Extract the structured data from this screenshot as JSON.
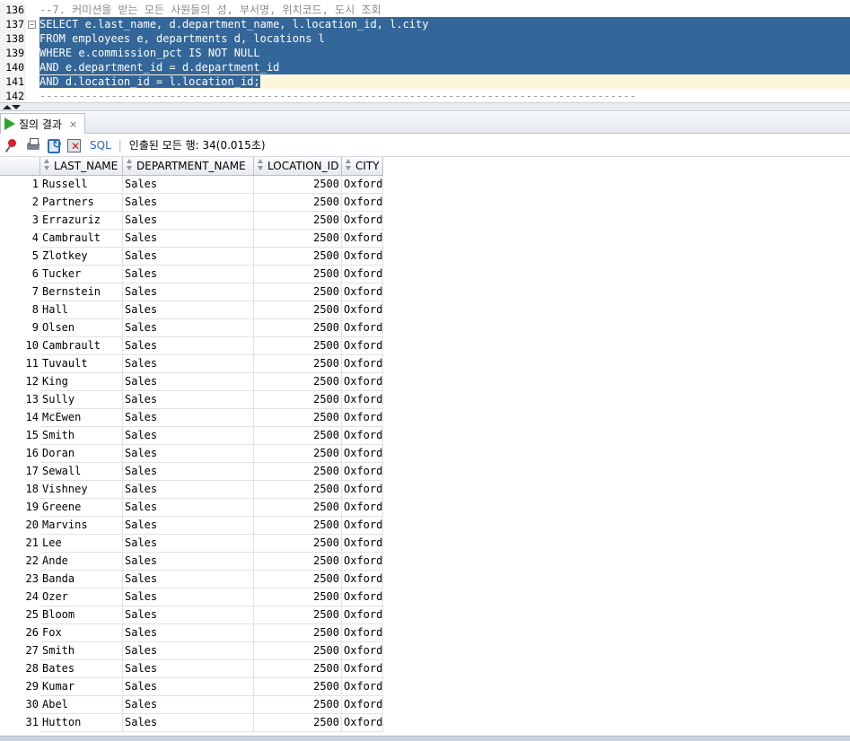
{
  "editor": {
    "lines": [
      {
        "num": "136",
        "text": "--7. 커미션을 받는 모든 사원들의 성, 부서명, 위치코드, 도시 조회",
        "kind": "cmt"
      },
      {
        "num": "137",
        "text": "SELECT e.last_name, d.department_name, l.location_id, l.city",
        "kind": "sel",
        "fold": true
      },
      {
        "num": "138",
        "text": "FROM employees e, departments d, locations l",
        "kind": "sel"
      },
      {
        "num": "139",
        "text": "WHERE e.commission_pct IS NOT NULL",
        "kind": "sel"
      },
      {
        "num": "140",
        "text": "AND e.department_id = d.department_id",
        "kind": "sel"
      },
      {
        "num": "141",
        "text": "AND d.location_id = l.location_id;",
        "kind": "cur"
      },
      {
        "num": "142",
        "text": "--------------------------------------------------------------------------------------------",
        "kind": "dash"
      }
    ],
    "fold_symbol": "⊟"
  },
  "results_tab": {
    "label": "질의 결과",
    "close": "×"
  },
  "toolbar": {
    "sql_label": "SQL",
    "separator": "|",
    "status": "인출된 모든 행: 34(0.015초)"
  },
  "grid": {
    "columns": [
      "LAST_NAME",
      "DEPARTMENT_NAME",
      "LOCATION_ID",
      "CITY"
    ],
    "rows": [
      [
        "1",
        "Russell",
        "Sales",
        "2500",
        "Oxford"
      ],
      [
        "2",
        "Partners",
        "Sales",
        "2500",
        "Oxford"
      ],
      [
        "3",
        "Errazuriz",
        "Sales",
        "2500",
        "Oxford"
      ],
      [
        "4",
        "Cambrault",
        "Sales",
        "2500",
        "Oxford"
      ],
      [
        "5",
        "Zlotkey",
        "Sales",
        "2500",
        "Oxford"
      ],
      [
        "6",
        "Tucker",
        "Sales",
        "2500",
        "Oxford"
      ],
      [
        "7",
        "Bernstein",
        "Sales",
        "2500",
        "Oxford"
      ],
      [
        "8",
        "Hall",
        "Sales",
        "2500",
        "Oxford"
      ],
      [
        "9",
        "Olsen",
        "Sales",
        "2500",
        "Oxford"
      ],
      [
        "10",
        "Cambrault",
        "Sales",
        "2500",
        "Oxford"
      ],
      [
        "11",
        "Tuvault",
        "Sales",
        "2500",
        "Oxford"
      ],
      [
        "12",
        "King",
        "Sales",
        "2500",
        "Oxford"
      ],
      [
        "13",
        "Sully",
        "Sales",
        "2500",
        "Oxford"
      ],
      [
        "14",
        "McEwen",
        "Sales",
        "2500",
        "Oxford"
      ],
      [
        "15",
        "Smith",
        "Sales",
        "2500",
        "Oxford"
      ],
      [
        "16",
        "Doran",
        "Sales",
        "2500",
        "Oxford"
      ],
      [
        "17",
        "Sewall",
        "Sales",
        "2500",
        "Oxford"
      ],
      [
        "18",
        "Vishney",
        "Sales",
        "2500",
        "Oxford"
      ],
      [
        "19",
        "Greene",
        "Sales",
        "2500",
        "Oxford"
      ],
      [
        "20",
        "Marvins",
        "Sales",
        "2500",
        "Oxford"
      ],
      [
        "21",
        "Lee",
        "Sales",
        "2500",
        "Oxford"
      ],
      [
        "22",
        "Ande",
        "Sales",
        "2500",
        "Oxford"
      ],
      [
        "23",
        "Banda",
        "Sales",
        "2500",
        "Oxford"
      ],
      [
        "24",
        "Ozer",
        "Sales",
        "2500",
        "Oxford"
      ],
      [
        "25",
        "Bloom",
        "Sales",
        "2500",
        "Oxford"
      ],
      [
        "26",
        "Fox",
        "Sales",
        "2500",
        "Oxford"
      ],
      [
        "27",
        "Smith",
        "Sales",
        "2500",
        "Oxford"
      ],
      [
        "28",
        "Bates",
        "Sales",
        "2500",
        "Oxford"
      ],
      [
        "29",
        "Kumar",
        "Sales",
        "2500",
        "Oxford"
      ],
      [
        "30",
        "Abel",
        "Sales",
        "2500",
        "Oxford"
      ],
      [
        "31",
        "Hutton",
        "Sales",
        "2500",
        "Oxford"
      ]
    ]
  },
  "colors": {
    "selection": "#336699",
    "current_line": "#fdf5dc",
    "run_icon": "#2fa530",
    "sql_link": "#2c63c4"
  }
}
